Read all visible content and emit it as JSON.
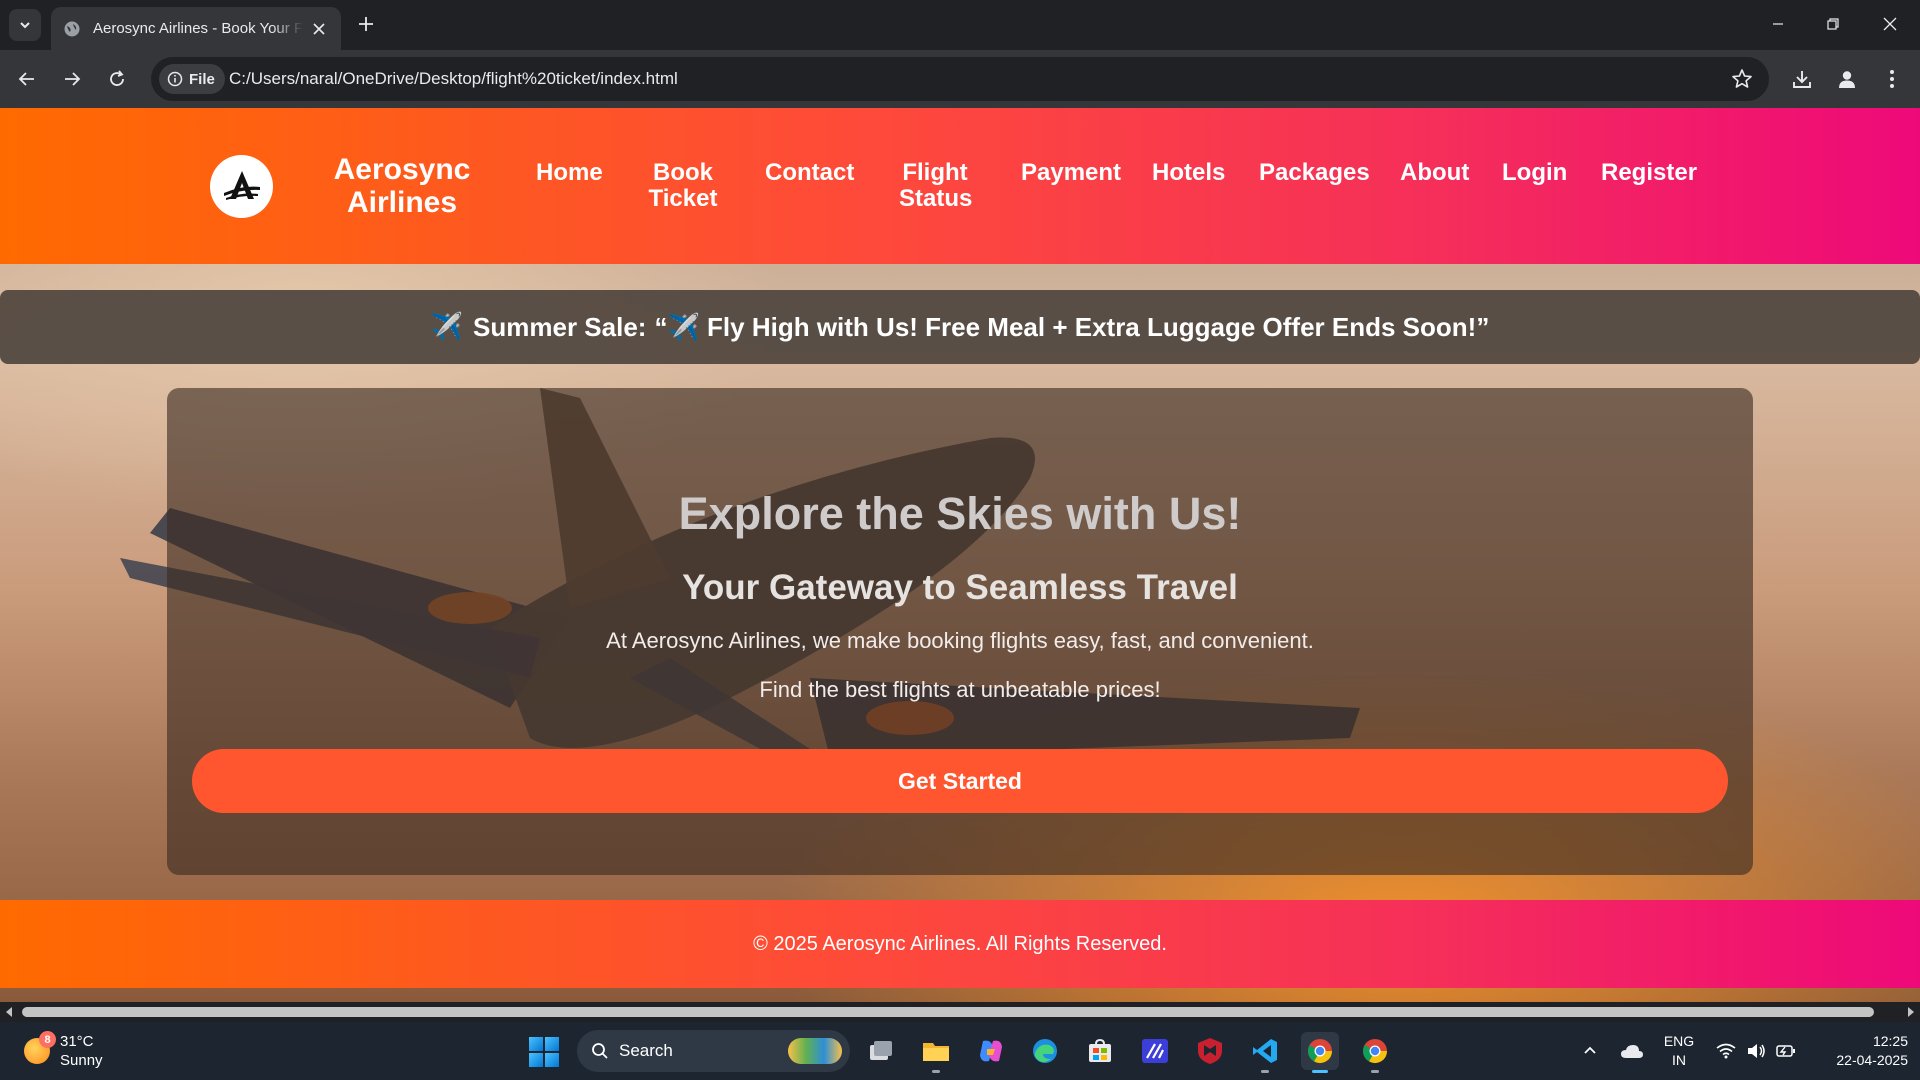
{
  "browser": {
    "tab_title": "Aerosync Airlines - Book Your Flight",
    "new_tab_symbol": "+",
    "file_chip_label": "File",
    "url": "C:/Users/naral/OneDrive/Desktop/flight%20ticket/index.html"
  },
  "site": {
    "brand": "Aerosync Airlines",
    "nav": [
      {
        "label": "Home"
      },
      {
        "label": "Book Ticket"
      },
      {
        "label": "Contact"
      },
      {
        "label": "Flight Status"
      },
      {
        "label": "Payment"
      },
      {
        "label": "Hotels"
      },
      {
        "label": "Packages"
      },
      {
        "label": "About"
      },
      {
        "label": "Login"
      },
      {
        "label": "Register"
      }
    ],
    "sale": {
      "emoji": "✈️",
      "lead": "Summer Sale:",
      "message": "“✈️ Fly High with Us! Free Meal + Extra Luggage Offer Ends Soon!”"
    },
    "hero": {
      "title": "Explore the Skies with Us!",
      "subtitle": "Your Gateway to Seamless Travel",
      "paragraph1": "At Aerosync Airlines, we make booking flights easy, fast, and convenient.",
      "paragraph2": "Find the best flights at unbeatable prices!",
      "cta_label": "Get Started"
    },
    "footer": "© 2025 Aerosync Airlines. All Rights Reserved."
  },
  "taskbar": {
    "weather_temp": "31°C",
    "weather_desc": "Sunny",
    "weather_badge": "8",
    "search_label": "Search",
    "lang_line1": "ENG",
    "lang_line2": "IN",
    "time": "12:25",
    "date": "22-04-2025"
  },
  "colors": {
    "gradient_start": "#ff6a00",
    "gradient_end": "#ee0979",
    "cta": "#ff5630",
    "browser_bg": "#202124",
    "taskbar_bg": "#1c2530"
  }
}
